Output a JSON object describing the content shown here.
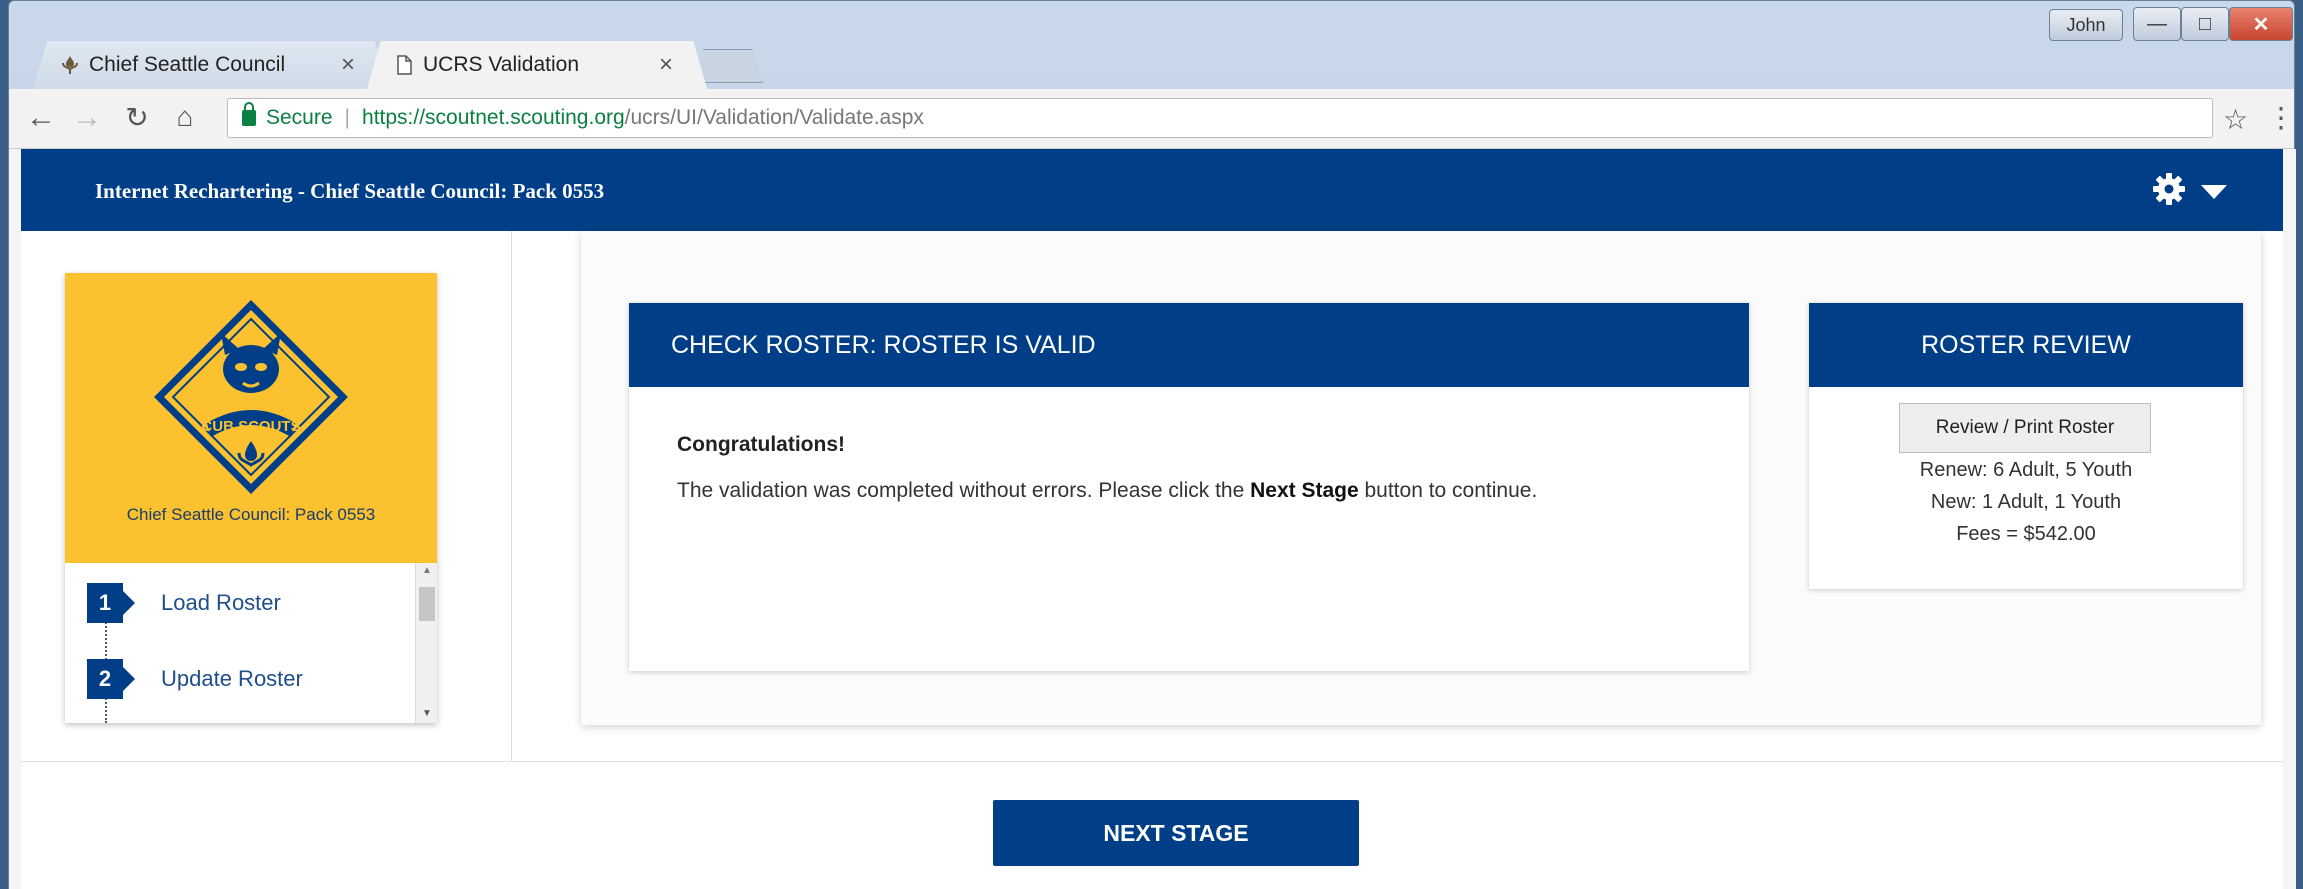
{
  "browser": {
    "tabs": [
      {
        "label": "Chief Seattle Council"
      },
      {
        "label": "UCRS Validation"
      }
    ],
    "user_label": "John",
    "omnibox": {
      "secure_label": "Secure",
      "url_host": "https://scoutnet.scouting.org",
      "url_path": "/ucrs/UI/Validation/Validate.aspx"
    }
  },
  "header": {
    "title": "Internet Rechartering - Chief Seattle Council: Pack 0553"
  },
  "sidebar": {
    "unit_name": "Chief Seattle Council: Pack 0553",
    "logo_text": "CUB SCOUTS",
    "steps": [
      {
        "number": "1",
        "label": "Load Roster"
      },
      {
        "number": "2",
        "label": "Update Roster"
      }
    ]
  },
  "check_roster": {
    "heading": "CHECK ROSTER: ROSTER IS VALID",
    "congrats": "Congratulations!",
    "message_before": "The validation was completed without errors. Please click the ",
    "message_bold": "Next Stage",
    "message_after": " button to continue."
  },
  "roster_review": {
    "heading": "ROSTER REVIEW",
    "button_label": "Review / Print Roster",
    "renew": "Renew: 6 Adult, 5 Youth",
    "new": "New: 1 Adult, 1 Youth",
    "fees": "Fees = $542.00"
  },
  "footer": {
    "next_label": "NEXT STAGE"
  },
  "colors": {
    "brand_blue": "#003f87",
    "scout_yellow": "#fbc12e",
    "secure_green": "#0b8043"
  }
}
